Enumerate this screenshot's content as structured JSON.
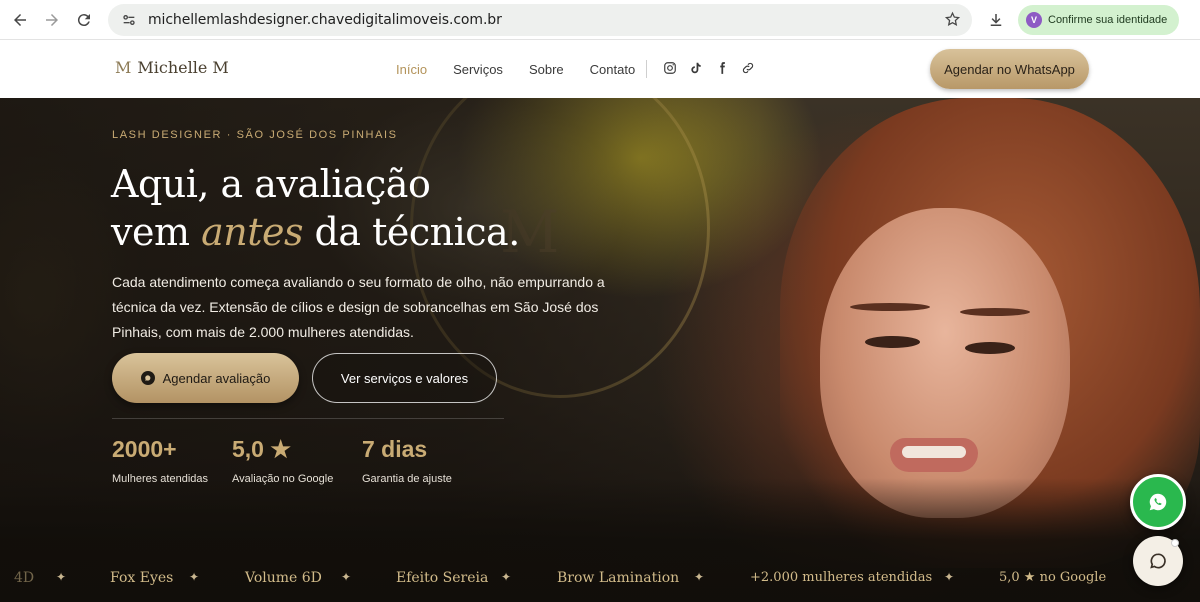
{
  "browser": {
    "url": "michellemlashdesigner.chavedigitalimoveis.com.br",
    "identity_badge": "V",
    "identity_label": "Confirme sua identidade"
  },
  "site": {
    "brand_mark": "M",
    "brand_name": "Michelle M",
    "menu": [
      {
        "label": "Início",
        "active": true
      },
      {
        "label": "Serviços",
        "active": false
      },
      {
        "label": "Sobre",
        "active": false
      },
      {
        "label": "Contato",
        "active": false
      }
    ],
    "socials": [
      "instagram-icon",
      "tiktok-icon",
      "facebook-icon",
      "link-icon"
    ],
    "header_cta": "Agendar no WhatsApp"
  },
  "hero": {
    "eyebrow": "LASH DESIGNER · SÃO JOSÉ DOS PINHAIS",
    "headline_line1": "Aqui, a avaliação",
    "headline_line2_pre": "vem ",
    "headline_line2_accent": "antes",
    "headline_line2_post": " da técnica.",
    "lead": "Cada atendimento começa avaliando o seu formato de olho, não empurrando a técnica da vez. Extensão de cílios e design de sobrancelhas em São José dos Pinhais, com mais de 2.000 mulheres atendidas.",
    "primary_cta": "Agendar avaliação",
    "secondary_cta": "Ver serviços e valores",
    "wall_mark": "M",
    "stats": [
      {
        "value": "2000+",
        "label": "Mulheres atendidas"
      },
      {
        "value": "5,0 ★",
        "label": "Avaliação no Google"
      },
      {
        "value": "7 dias",
        "label": "Garantia de ajuste"
      }
    ]
  },
  "marquee": {
    "items": [
      "4D",
      "Fox Eyes",
      "Volume 6D",
      "Efeito Sereia",
      "Brow Lamination",
      "+2.000 mulheres atendidas",
      "5,0 ★ no Google"
    ],
    "separator": "✦"
  },
  "colors": {
    "accent_gold": "#c9ab74",
    "whatsapp_green": "#2ab84e",
    "identity_bg": "#d3f1cf"
  }
}
